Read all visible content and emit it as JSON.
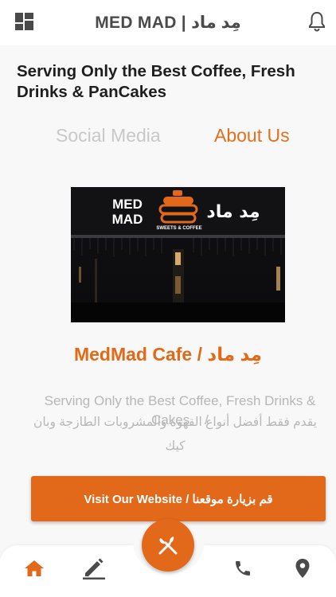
{
  "app": {
    "title": "MED MAD | مِد ماد"
  },
  "headline": "Serving Only the Best Coffee, Fresh Drinks & PanCakes",
  "tabs": [
    {
      "label": "Social Media",
      "active": false
    },
    {
      "label": "About Us",
      "active": true
    }
  ],
  "photo": {
    "sign_en_1": "MED",
    "sign_en_2": "MAD",
    "sign_sub": "SWEETS & COFFEE",
    "sign_ar": "مِد ماد"
  },
  "cafe_name": "MedMad Cafe / مِد ماد",
  "description": {
    "en": "Serving Only the Best Coffee, Fresh Drinks & Cakes",
    "ar": "يقدم فقط أفضل أنواع القهوة والمشروبات الطازجة وبان كيك",
    "separator": "/"
  },
  "visit_button": "Visit Our Website / قم بزيارة موقعنا",
  "bottom_nav": [
    "home-icon",
    "edit-icon",
    "restaurant-icon",
    "phone-icon",
    "location-icon"
  ],
  "colors": {
    "accent": "#e2681a",
    "tab_active": "#e0701c",
    "tab_inactive": "#c8c8c8",
    "icon": "#4a4a4a"
  }
}
